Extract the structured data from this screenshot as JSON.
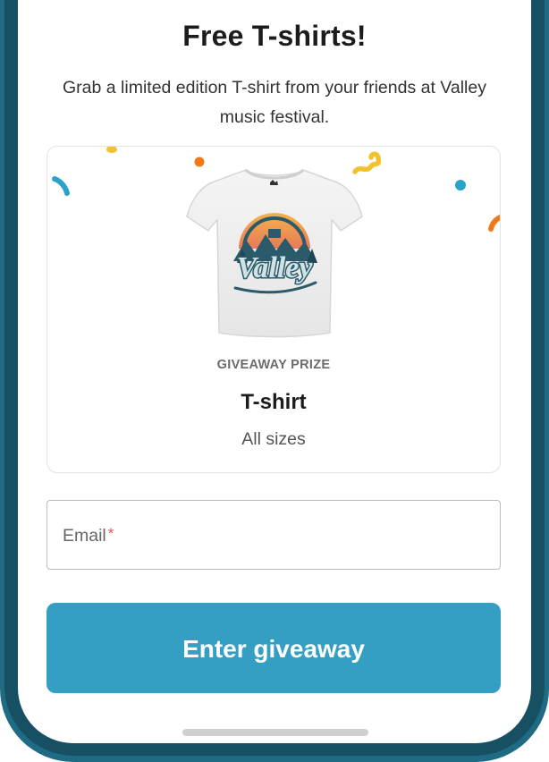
{
  "header": {
    "title": "Free T-shirts!",
    "subtitle": "Grab a limited edition T-shirt from your friends at Valley music festival."
  },
  "prize": {
    "label": "GIVEAWAY PRIZE",
    "name": "T-shirt",
    "description": "All sizes",
    "image_text": "Valley"
  },
  "form": {
    "email_label": "Email",
    "required_mark": "*"
  },
  "cta": {
    "label": "Enter giveaway"
  },
  "colors": {
    "accent": "#349fc2",
    "frame": "#1f6b83",
    "confetti_blue": "#2aa3c9",
    "confetti_orange": "#f07a1a",
    "confetti_yellow": "#f2c12e",
    "required": "#e05353"
  }
}
